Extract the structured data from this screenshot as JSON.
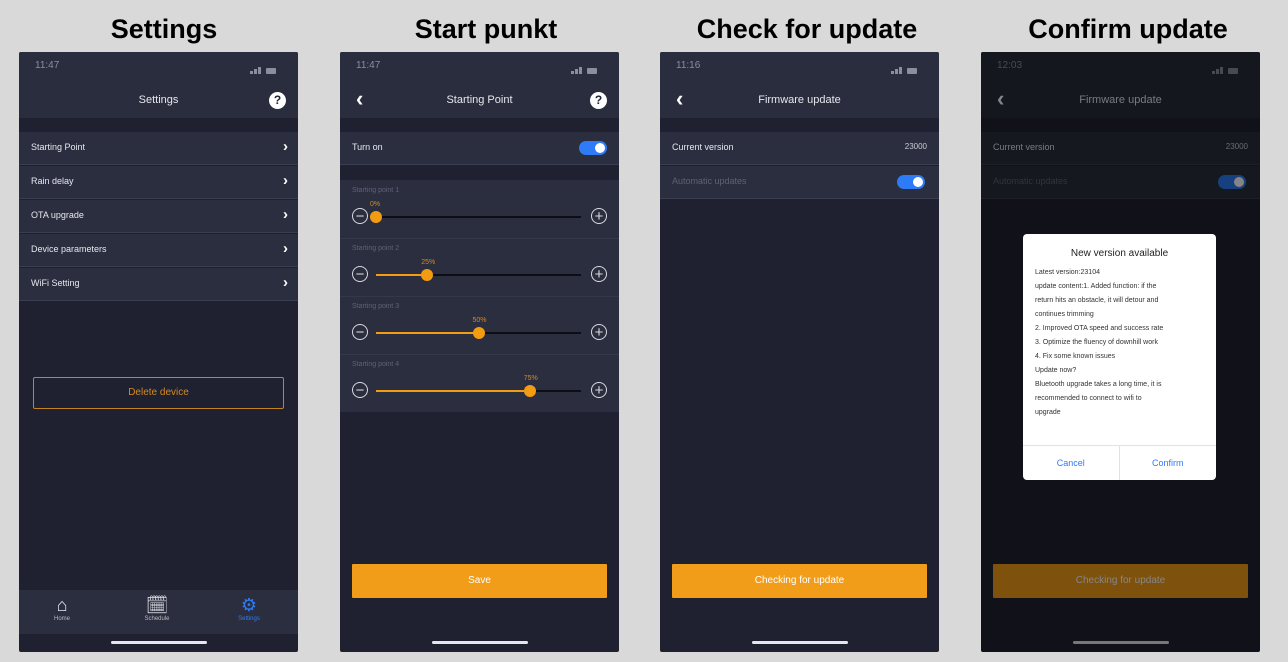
{
  "captions": [
    "Settings",
    "Start punkt",
    "Check for update",
    "Confirm update"
  ],
  "status": {
    "time1": "11:47",
    "time2": "11:47",
    "time3": "11:16",
    "time4": "12:03"
  },
  "settings": {
    "title": "Settings",
    "help": "?",
    "items": [
      {
        "label": "Starting Point"
      },
      {
        "label": "Rain delay"
      },
      {
        "label": "OTA upgrade"
      },
      {
        "label": "Device parameters"
      },
      {
        "label": "WiFi Setting"
      }
    ],
    "delete_label": "Delete device",
    "tabs": [
      {
        "label": "Home",
        "icon": "home-icon"
      },
      {
        "label": "Schedule",
        "icon": "schedule-icon"
      },
      {
        "label": "Settings",
        "icon": "gear-icon"
      }
    ]
  },
  "starting_point": {
    "title": "Starting Point",
    "turn_on_label": "Turn on",
    "turn_on": true,
    "points": [
      {
        "label": "Starting point 1",
        "value_label": "0%",
        "value": 0.0
      },
      {
        "label": "Starting point 2",
        "value_label": "25%",
        "value": 0.25
      },
      {
        "label": "Starting point 3",
        "value_label": "50%",
        "value": 0.5
      },
      {
        "label": "Starting point 4",
        "value_label": "75%",
        "value": 0.75
      }
    ],
    "save_label": "Save"
  },
  "firmware": {
    "title": "Firmware update",
    "current_version_label": "Current version",
    "current_version": "23000",
    "auto_updates_label": "Automatic updates",
    "auto_updates": true,
    "checking_label": "Checking for update"
  },
  "dialog": {
    "title": "New version available",
    "lines": [
      "Latest version:23104",
      "update content:1. Added function: if the",
      "return hits an obstacle, it will detour and",
      "continues trimming",
      "2. Improved OTA speed and success rate",
      "3. Optimize the fluency of downhill work",
      "4. Fix some known issues",
      "Update now?",
      "Bluetooth upgrade takes a long time, it is",
      "recommended to connect to wifi to",
      "upgrade"
    ],
    "cancel_label": "Cancel",
    "confirm_label": "Confirm"
  },
  "colors": {
    "accent": "#f19d1a",
    "toggle": "#2d7bf6",
    "background": "#1f2130"
  }
}
